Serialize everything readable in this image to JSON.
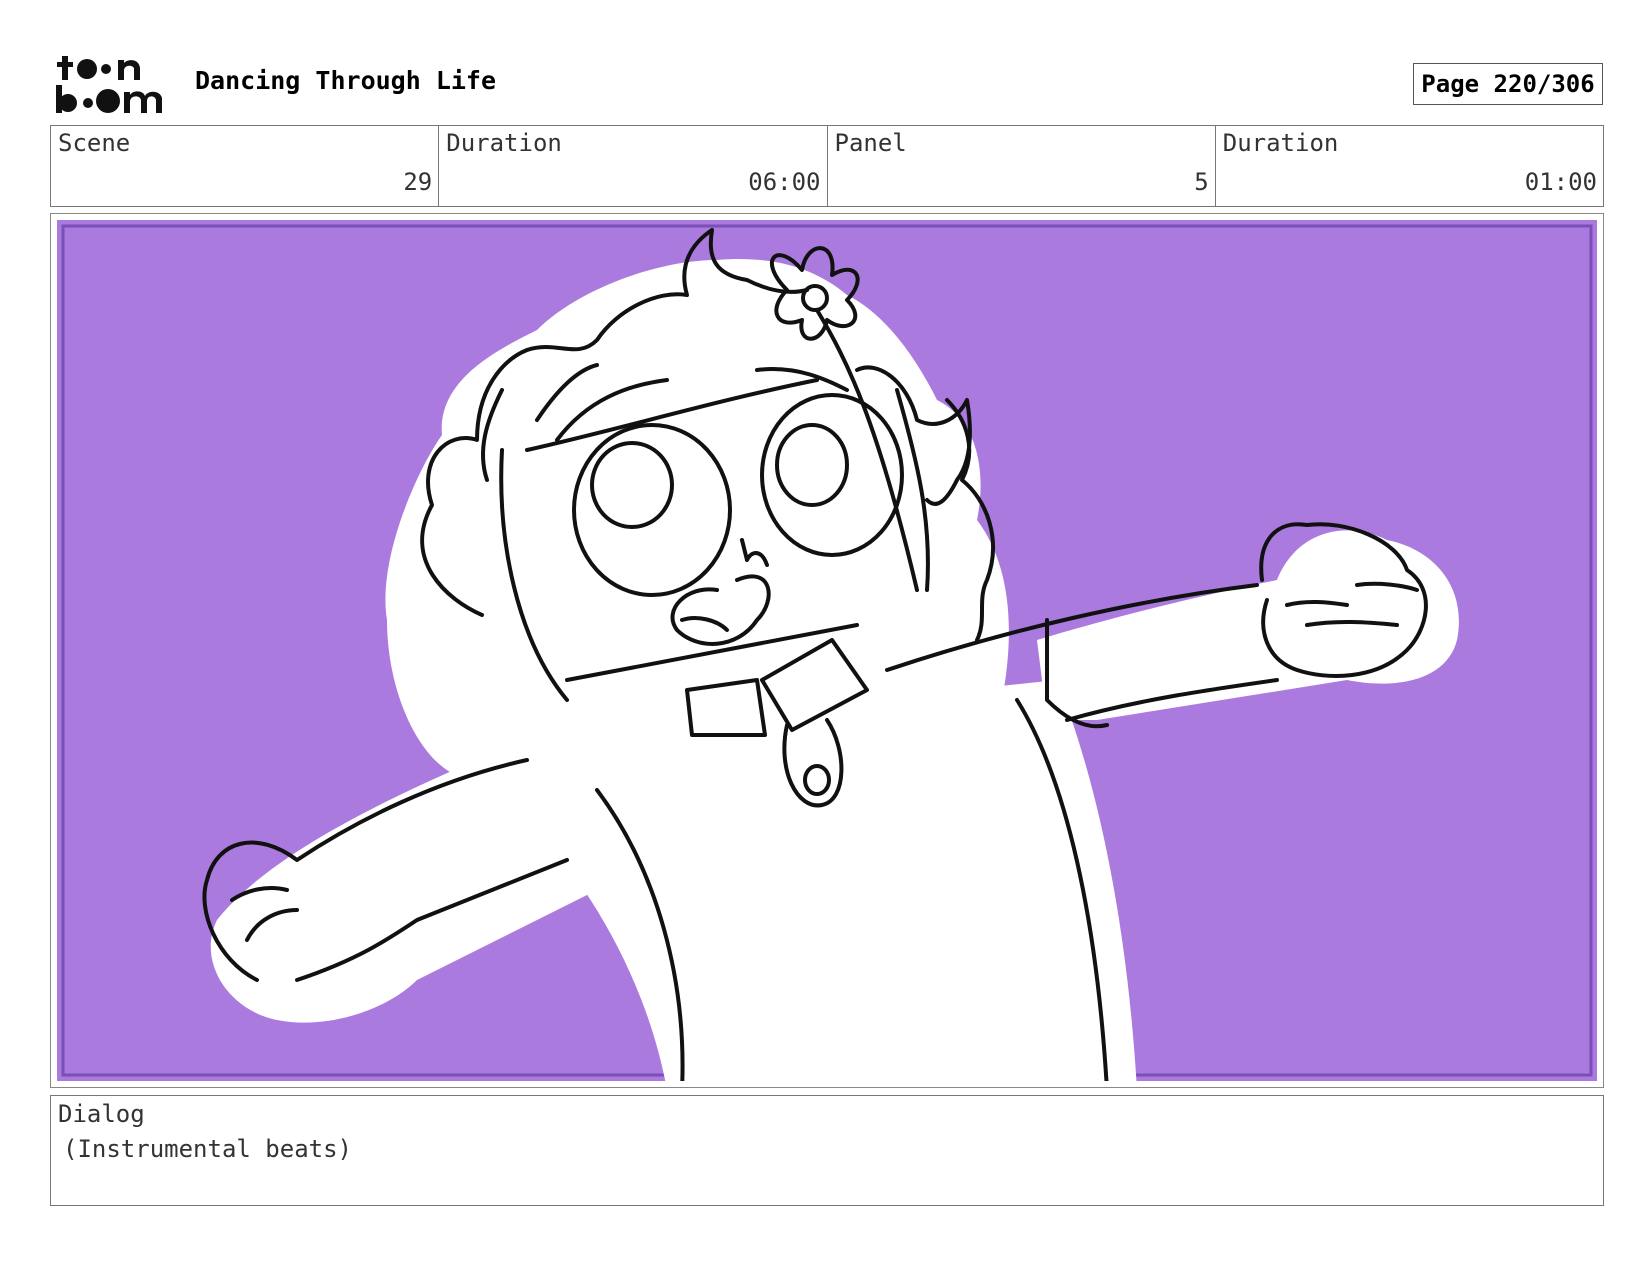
{
  "header": {
    "logo_text": "toon boom",
    "project_title": "Dancing Through Life",
    "page_label": "Page 220/306"
  },
  "info": {
    "scene_label": "Scene",
    "scene_value": "29",
    "scene_duration_label": "Duration",
    "scene_duration_value": "06:00",
    "panel_label": "Panel",
    "panel_value": "5",
    "panel_duration_label": "Duration",
    "panel_duration_value": "01:00"
  },
  "panel": {
    "background_color": "#ab7ade",
    "border_color": "#7a4fb8"
  },
  "dialog": {
    "label": "Dialog",
    "text": "(Instrumental beats)"
  }
}
